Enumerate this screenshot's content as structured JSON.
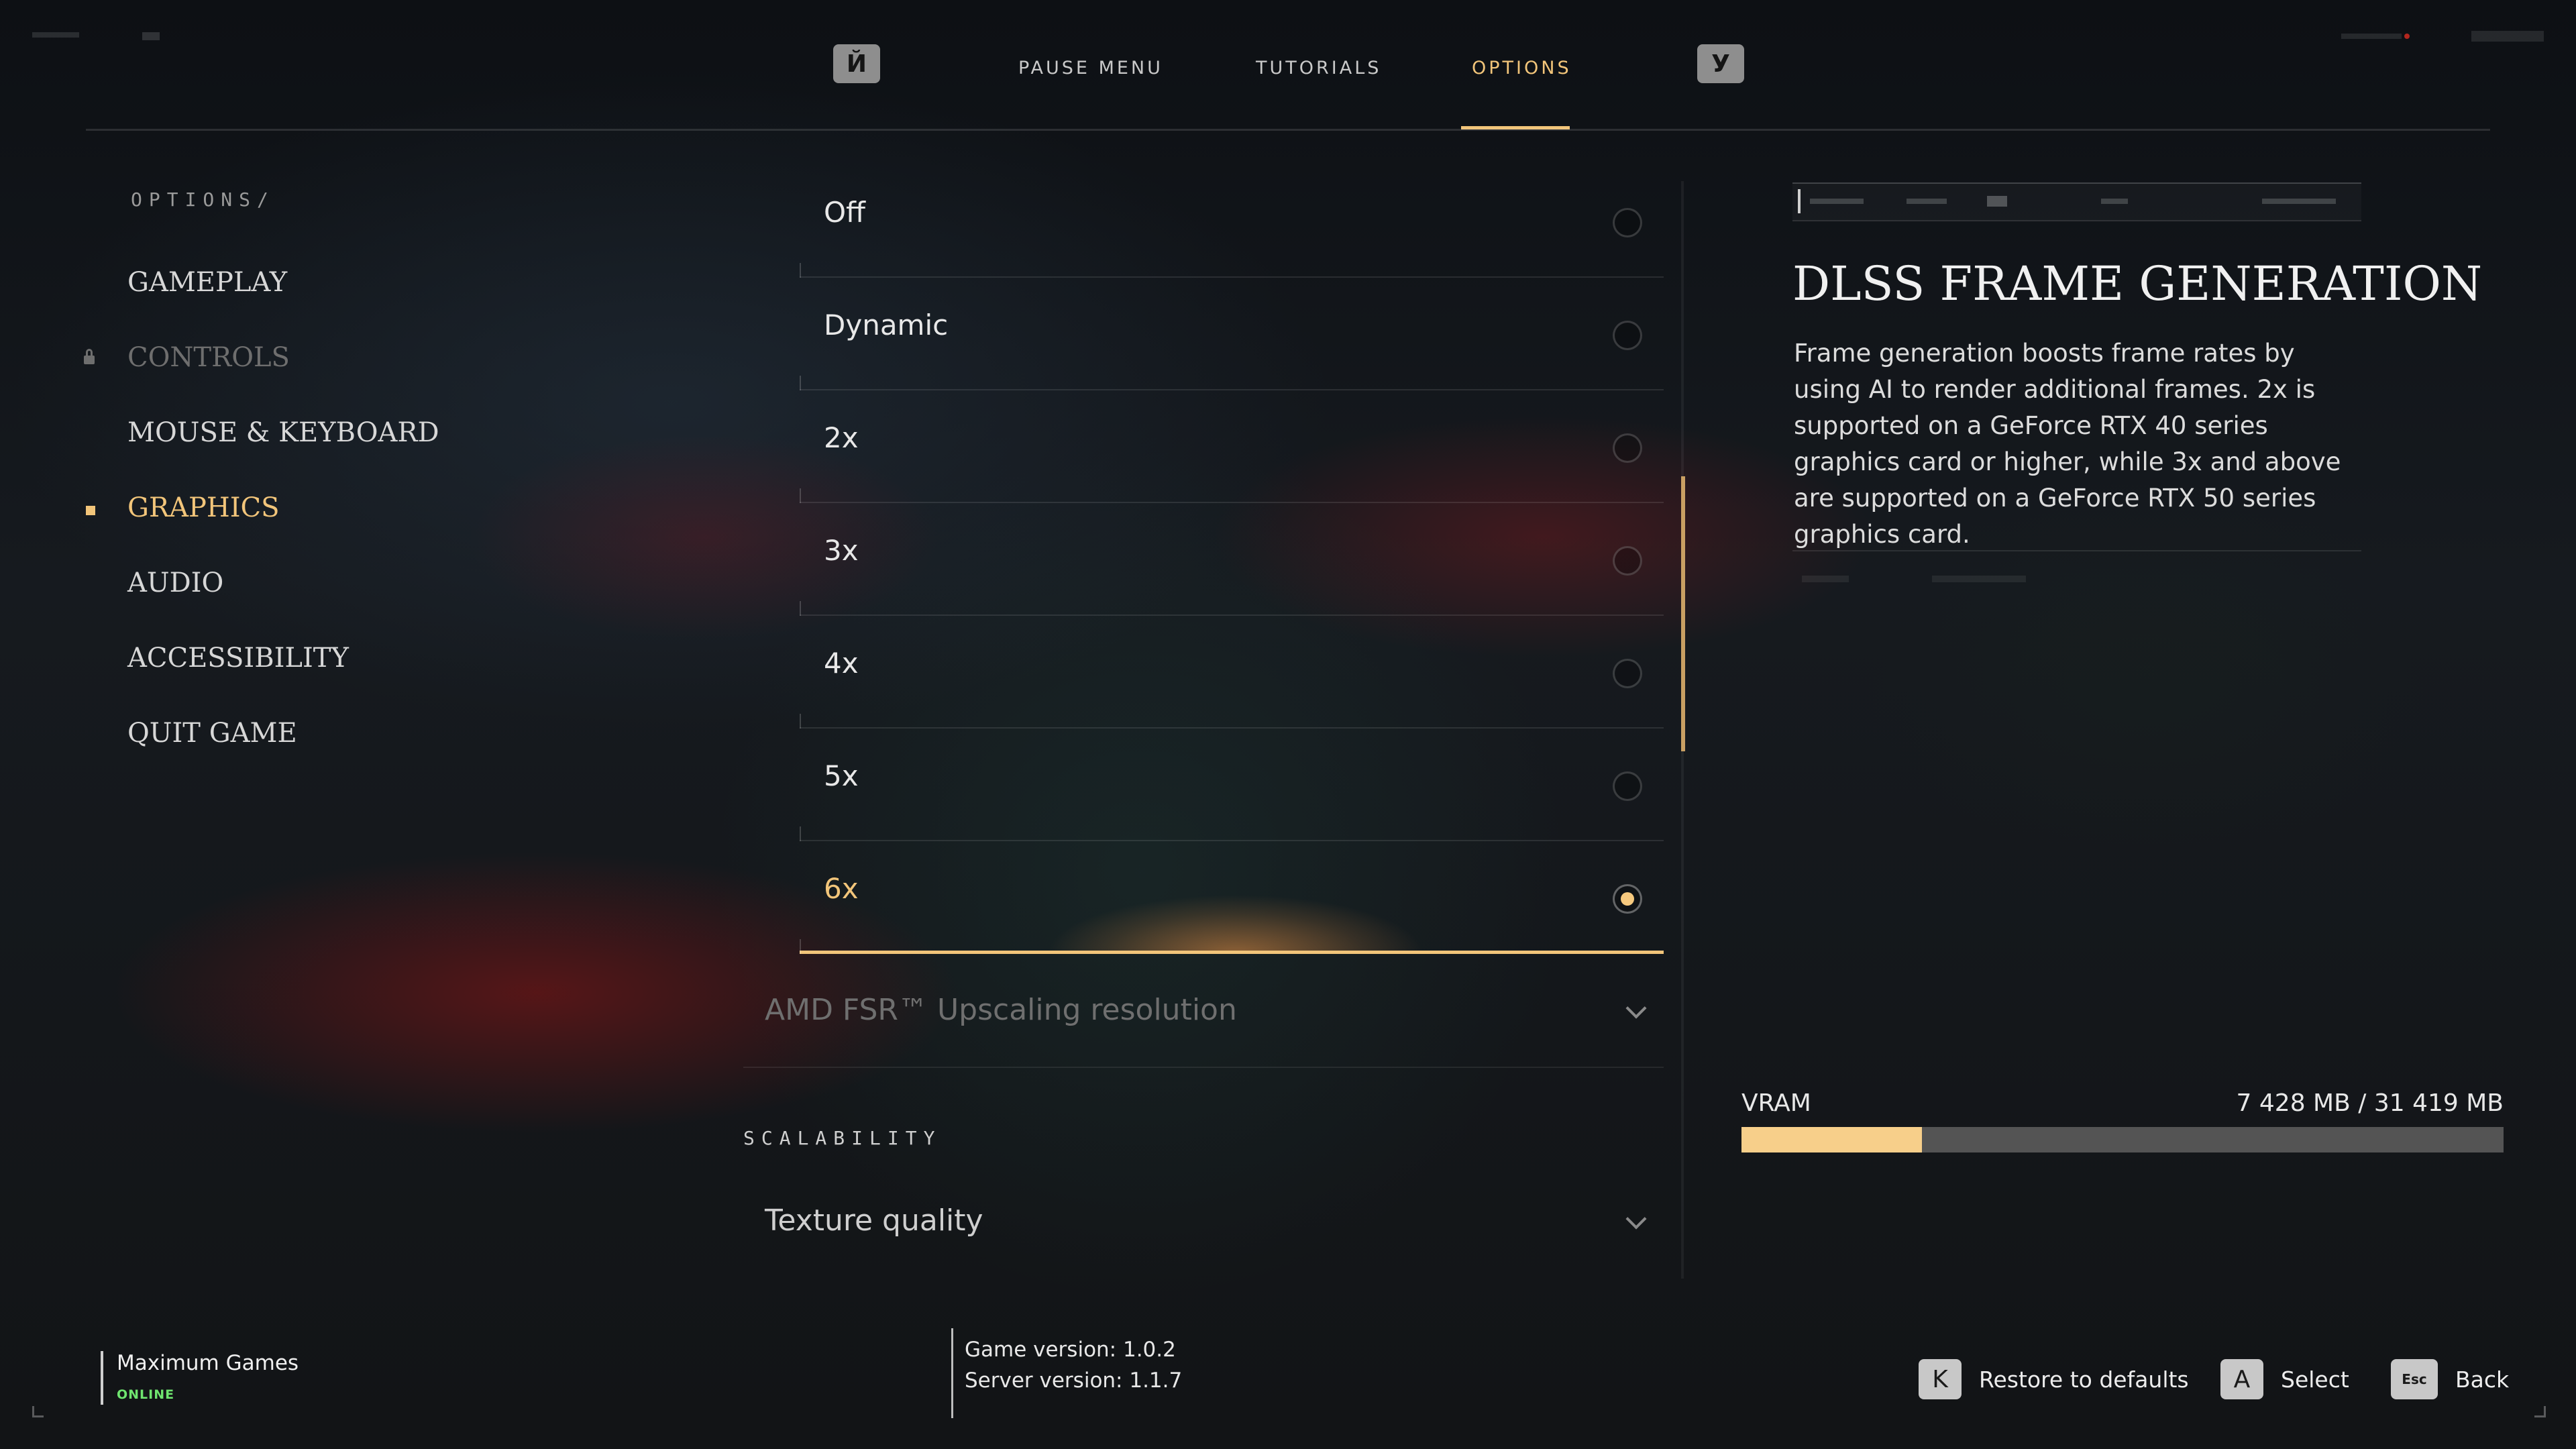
{
  "nav": {
    "left_key": "Й",
    "right_key": "У",
    "tabs": [
      {
        "label": "PAUSE MENU"
      },
      {
        "label": "TUTORIALS"
      },
      {
        "label": "OPTIONS"
      }
    ],
    "active_tab": "OPTIONS"
  },
  "sidebar": {
    "breadcrumb": "OPTIONS/",
    "items": [
      {
        "label": "GAMEPLAY",
        "state": "normal"
      },
      {
        "label": "CONTROLS",
        "state": "locked"
      },
      {
        "label": "MOUSE & KEYBOARD",
        "state": "normal"
      },
      {
        "label": "GRAPHICS",
        "state": "active"
      },
      {
        "label": "AUDIO",
        "state": "normal"
      },
      {
        "label": "ACCESSIBILITY",
        "state": "normal"
      },
      {
        "label": "QUIT GAME",
        "state": "normal"
      }
    ]
  },
  "options": {
    "frame_generation_choices": [
      "Off",
      "Dynamic",
      "2x",
      "3x",
      "4x",
      "5x",
      "6x"
    ],
    "selected_choice": "6x",
    "upscaling_dropdown": "AMD FSR™ Upscaling resolution",
    "section_heading": "SCALABILITY",
    "texture_dropdown": "Texture quality"
  },
  "info": {
    "title": "DLSS FRAME GENERATION",
    "description": "Frame generation boosts frame rates by using AI to render additional frames. 2x is supported on a GeForce RTX 40 series graphics card or higher, while 3x and above are supported on a GeForce RTX 50 series graphics card."
  },
  "vram": {
    "label": "VRAM",
    "value": "7 428 MB / 31 419 MB",
    "used_fraction": 0.2364
  },
  "footer": {
    "user_name": "Maximum Games",
    "user_status": "ONLINE",
    "game_version": "Game version: 1.0.2",
    "server_version": "Server version: 1.1.7",
    "hints": [
      {
        "key": "K",
        "label": "Restore to defaults"
      },
      {
        "key": "A",
        "label": "Select"
      },
      {
        "key": "Esc",
        "label": "Back"
      }
    ]
  },
  "colors": {
    "accent": "#f2c57a",
    "online": "#6fe46f",
    "vram_fill": "#f7cf8a",
    "vram_track": "#545454"
  }
}
